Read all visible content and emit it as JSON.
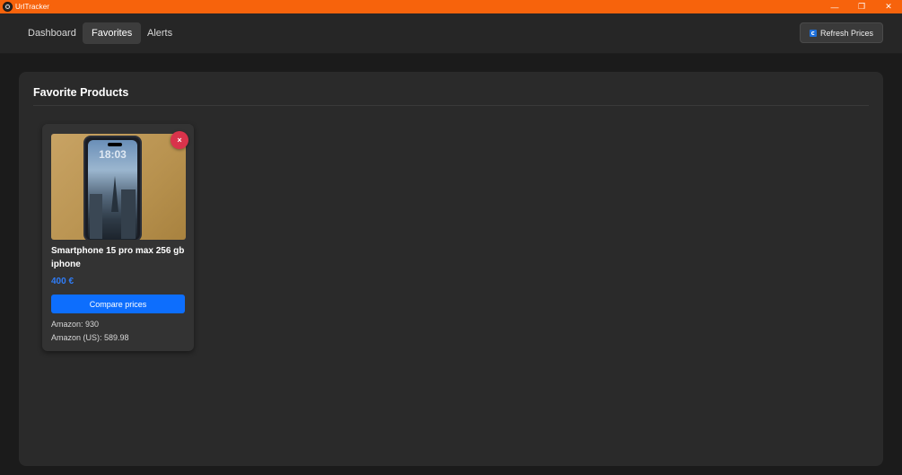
{
  "window": {
    "title": "UrlTracker",
    "controls": {
      "minimize": "—",
      "maximize": "❐",
      "close": "✕"
    },
    "accent_color": "#f7630c"
  },
  "nav": {
    "tabs": [
      {
        "label": "Dashboard",
        "active": false
      },
      {
        "label": "Favorites",
        "active": true
      },
      {
        "label": "Alerts",
        "active": false
      }
    ],
    "refresh_label": "Refresh Prices",
    "refresh_icon": "refresh-icon"
  },
  "favorites": {
    "heading": "Favorite Products",
    "products": [
      {
        "name": "Smartphone 15 pro max 256 gb iphone",
        "price": "400 €",
        "image_time": "18:03",
        "compare_label": "Compare prices",
        "remove_label": "×",
        "offers": [
          "Amazon: 930",
          "Amazon (US): 589.98"
        ]
      }
    ]
  },
  "colors": {
    "primary_button": "#0d6efd",
    "price_text": "#2f7cf6",
    "remove_button": "#d9334b"
  }
}
